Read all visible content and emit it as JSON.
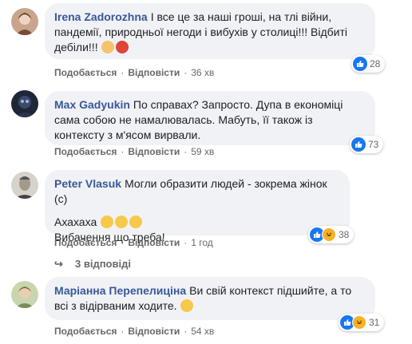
{
  "comments": [
    {
      "author": "Irena Zadorozhna",
      "text": "І все це за наші гроші, на тлі війни, пандемії, природньої негоди і вибухів у столиці!!! Відбиті дебіли!!!",
      "reactions": "28",
      "like_label": "Подобається",
      "reply_label": "Відповісти",
      "time": "36 хв"
    },
    {
      "author": "Max Gadyukin",
      "text": "По справах? Запросто. Дупа в економіці сама собою не намалювалась. Мабуть, її також із контексту з м'ясом вирвали.",
      "reactions": "73",
      "like_label": "Подобається",
      "reply_label": "Відповісти",
      "time": "59 хв"
    },
    {
      "author": "Peter Vlasuk",
      "text": "Могли образити людей - зокрема жінок (с)",
      "text2": "Ахахаха",
      "text3": "Вибачення що треба!",
      "reactions": "38",
      "like_label": "Подобається",
      "reply_label": "Відповісти",
      "time": "1 год"
    },
    {
      "author": "Маріанна Перепелиціна",
      "text": "Ви свій контекст підшийте, а то всі з відірваним ходите.",
      "reactions": "31",
      "like_label": "Подобається",
      "reply_label": "Відповісти",
      "time": "54 хв"
    }
  ],
  "replies_label": "3 відповіді",
  "colors": {
    "author": "#385898",
    "bubble": "#f0f2f5",
    "like": "#1877f2",
    "haha": "#f7b125"
  }
}
